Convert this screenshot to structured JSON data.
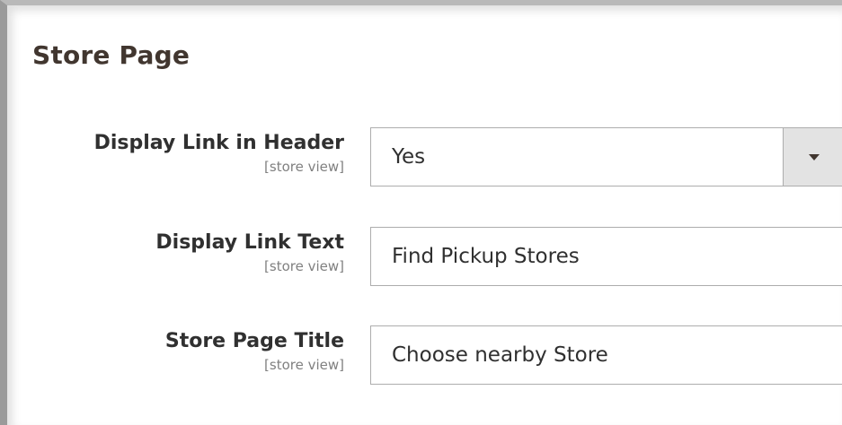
{
  "section": {
    "title": "Store Page"
  },
  "fields": [
    {
      "label": "Display Link in Header",
      "scope": "[store view]",
      "type": "select",
      "value": "Yes",
      "icon": "chevron-down-icon"
    },
    {
      "label": "Display Link Text",
      "scope": "[store view]",
      "type": "text",
      "value": "Find Pickup Stores"
    },
    {
      "label": "Store Page Title",
      "scope": "[store view]",
      "type": "text",
      "value": "Choose nearby Store"
    }
  ],
  "colors": {
    "title": "#41362f",
    "label": "#303030",
    "scope": "#808080",
    "border": "#adadad",
    "select_button_bg": "#e3e3e3"
  }
}
